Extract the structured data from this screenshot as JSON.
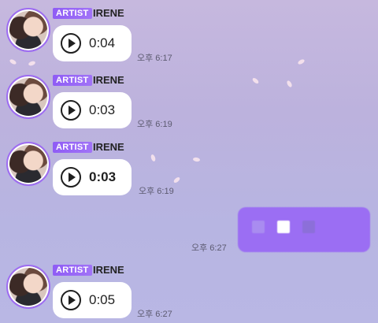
{
  "messages": [
    {
      "badge": "ARTIST",
      "name": "IRENE",
      "duration": "0:04",
      "time": "오후 6:17"
    },
    {
      "badge": "ARTIST",
      "name": "IRENE",
      "duration": "0:03",
      "time": "오후 6:19"
    },
    {
      "badge": "ARTIST",
      "name": "IRENE",
      "duration": "0:03",
      "time": "오후 6:19"
    },
    {
      "badge": "ARTIST",
      "name": "IRENE",
      "duration": "0:05",
      "time": "오후 6:27"
    }
  ],
  "my_message": {
    "time": "오후 6:27"
  },
  "colors": {
    "accent": "#9d6cf2",
    "badge": "#8f5cf5",
    "my_bubble": "#9b6ef3",
    "bubble": "#ffffff",
    "background_top": "#c6b8de",
    "background_bottom": "#b9b7e4"
  },
  "icons": [
    "play-icon",
    "avatar",
    "petal"
  ]
}
